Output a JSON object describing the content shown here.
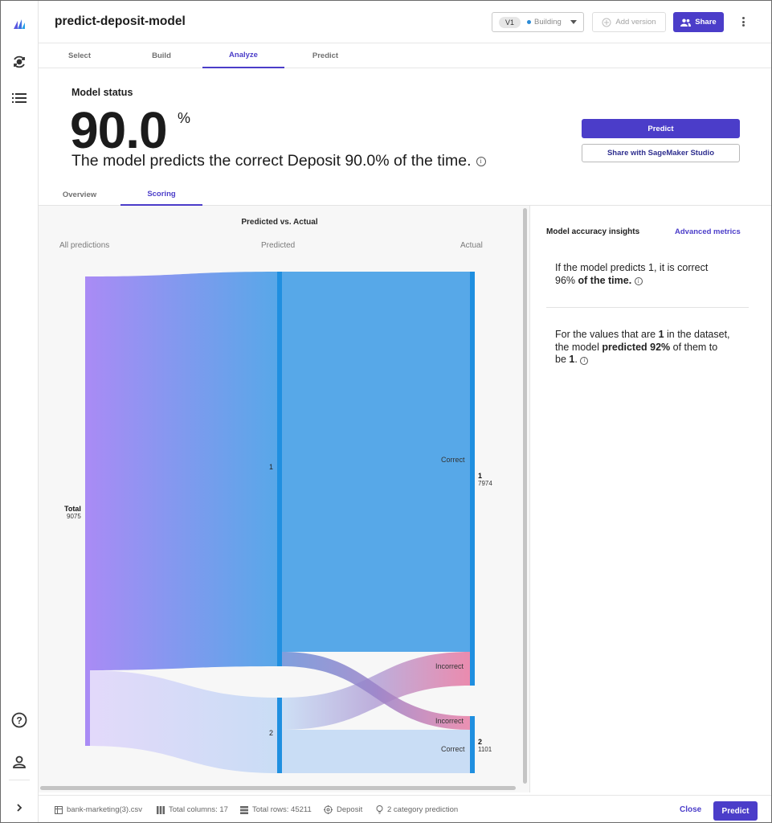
{
  "app": {
    "title": "predict-deposit-model",
    "version_pill": "V1",
    "version_status": "Building",
    "add_version": "Add version",
    "share": "Share"
  },
  "main_tabs": [
    {
      "label": "Select",
      "active": false
    },
    {
      "label": "Build",
      "active": false
    },
    {
      "label": "Analyze",
      "active": true
    },
    {
      "label": "Predict",
      "active": false
    }
  ],
  "status": {
    "label": "Model status",
    "value": "90.0",
    "unit": "%",
    "sentence": "The model predicts the correct Deposit 90.0% of the time.",
    "predict_btn": "Predict",
    "share_studio_btn": "Share with SageMaker Studio"
  },
  "sub_tabs": [
    {
      "label": "Overview",
      "active": false
    },
    {
      "label": "Scoring",
      "active": true
    }
  ],
  "chart": {
    "title": "Predicted vs. Actual",
    "col_all": "All predictions",
    "col_predicted": "Predicted",
    "col_actual": "Actual",
    "total_label": "Total",
    "total_value": "9075",
    "pred_1_label": "1",
    "pred_2_label": "2",
    "actual_1_label": "1",
    "actual_1_value": "7974",
    "actual_2_label": "2",
    "actual_2_value": "1101",
    "correct_label": "Correct",
    "incorrect_label": "Incorrect"
  },
  "chart_data": {
    "type": "sankey",
    "title": "Predicted vs. Actual",
    "columns": [
      "All predictions",
      "Predicted",
      "Actual"
    ],
    "nodes": [
      {
        "name": "Total",
        "value": 9075
      },
      {
        "name": "Predicted 1"
      },
      {
        "name": "Predicted 2"
      },
      {
        "name": "Actual 1",
        "value": 7974
      },
      {
        "name": "Actual 2",
        "value": 1101
      }
    ],
    "flow_labels": [
      "Correct",
      "Incorrect",
      "Incorrect",
      "Correct"
    ]
  },
  "insights": {
    "title": "Model accuracy insights",
    "advanced_link": "Advanced metrics",
    "i1_a": "If the model predicts 1, it is correct",
    "i1_b": "96%",
    "i1_c": "of the time.",
    "i2_a": "For the values that are",
    "i2_b": "1",
    "i2_c": "in the dataset,",
    "i2_d": "the model",
    "i2_e": "predicted 92%",
    "i2_f": "of them to",
    "i2_g": "be",
    "i2_h": "1",
    "i2_i": "."
  },
  "footer": {
    "dataset": "bank-marketing(3).csv",
    "columns": "Total columns: 17",
    "rows": "Total rows: 45211",
    "target": "Deposit",
    "problem": "2 category prediction",
    "close": "Close",
    "predict": "Predict"
  },
  "colors": {
    "accent": "#4b3dc9",
    "node_blue": "#1f8fe0",
    "flow_blue": "#57a8e8",
    "flow_light": "#c9ddf5",
    "flow_pink": "#e97fa6",
    "node_purple": "#a98bf5"
  }
}
